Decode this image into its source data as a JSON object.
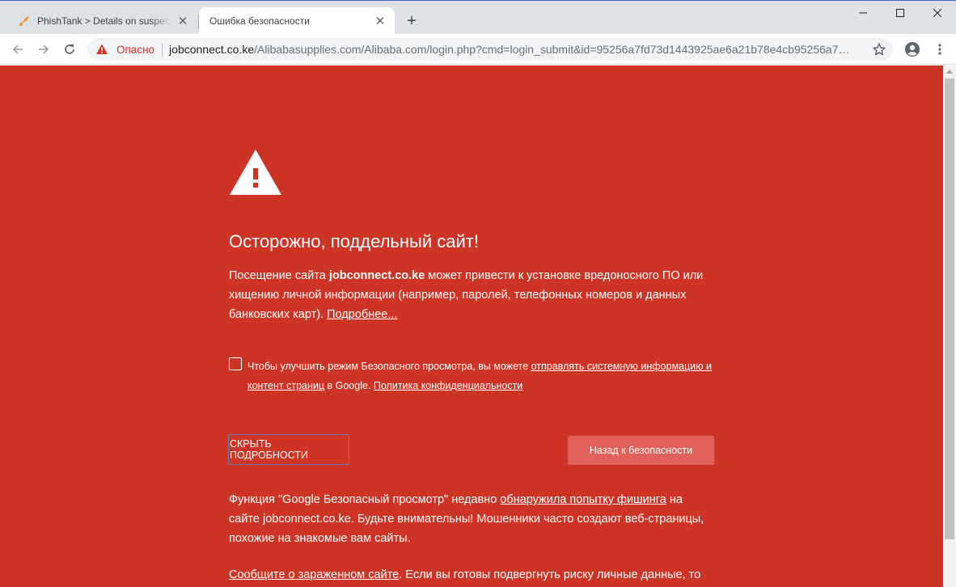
{
  "tabs": [
    {
      "title": "PhishTank > Details on suspected phish",
      "active": false
    },
    {
      "title": "Ошибка безопасности",
      "active": true
    }
  ],
  "omnibox": {
    "security_label": "Опасно",
    "host": "jobconnect.co.ke",
    "path": "/Alibabasupplies.com/Alibaba.com/login.php?cmd=login_submit&id=95256a7fd73d1443925ae6a21b78e4cb95256a7fd..."
  },
  "colors": {
    "page_bg": "#ce3426",
    "danger_text": "#d93025",
    "primary_button_bg": "#e0615a"
  },
  "icons": [
    "phishtank-favicon",
    "close-icon",
    "new-tab-icon",
    "minimize-icon",
    "maximize-icon",
    "window-close-icon",
    "back-icon",
    "forward-icon",
    "reload-icon",
    "warning-icon",
    "bookmark-star-icon",
    "profile-icon",
    "menu-icon",
    "warning-triangle-icon"
  ],
  "interstitial": {
    "heading": "Осторожно, поддельный сайт!",
    "para1_prefix": "Посещение сайта ",
    "para1_site": "jobconnect.co.ke",
    "para1_body": " может привести к установке вредоносного ПО или хищению личной информации (например, паролей, телефонных номеров и данных банковских карт). ",
    "learn_more": "Подробнее...",
    "checkbox_prefix": "Чтобы улучшить режим Безопасного просмотра, вы можете ",
    "checkbox_link": "отправлять системную информацию и контент страниц",
    "checkbox_mid": " в Google. ",
    "privacy_link": "Политика конфиденциальности",
    "hide_details": "СКРЫТЬ ПОДРОБНОСТИ",
    "back_to_safety": "Назад к безопасности",
    "para2_prefix": "Функция \"Google Безопасный просмотр\" недавно ",
    "para2_link": "обнаружила попытку фишинга",
    "para2_body": " на сайте jobconnect.co.ke. Будьте внимательны! Мошенники часто создают веб-страницы, похожие на знакомые вам сайты.",
    "report_link": "Сообщите о зараженном сайте",
    "para3_body": ". Если вы готовы подвергнуть риску личные данные, то"
  }
}
